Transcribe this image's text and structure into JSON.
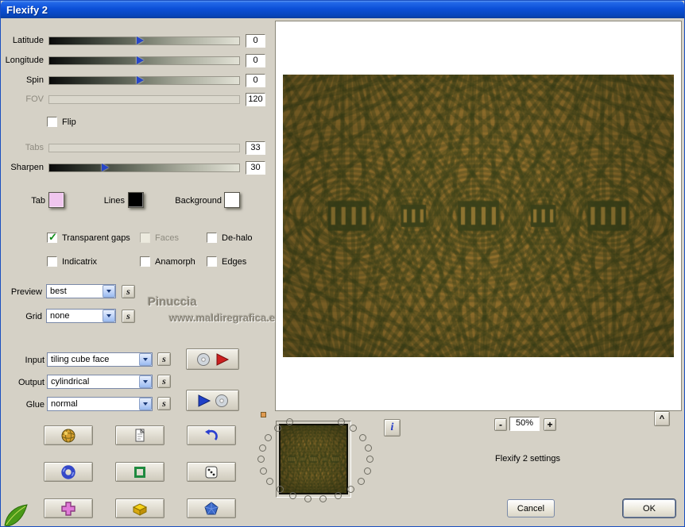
{
  "window": {
    "title": "Flexify 2"
  },
  "sliders": {
    "latitude": {
      "label": "Latitude",
      "value": "0"
    },
    "longitude": {
      "label": "Longitude",
      "value": "0"
    },
    "spin": {
      "label": "Spin",
      "value": "0"
    },
    "fov": {
      "label": "FOV",
      "value": "120"
    },
    "tabs": {
      "label": "Tabs",
      "value": "33"
    },
    "sharpen": {
      "label": "Sharpen",
      "value": "30"
    }
  },
  "checkboxes": {
    "flip": {
      "label": "Flip",
      "checked": false
    },
    "transparent_gaps": {
      "label": "Transparent gaps",
      "checked": true
    },
    "faces": {
      "label": "Faces",
      "checked": false
    },
    "dehalo": {
      "label": "De-halo",
      "checked": false
    },
    "indicatrix": {
      "label": "Indicatrix",
      "checked": false
    },
    "anamorph": {
      "label": "Anamorph",
      "checked": false
    },
    "edges": {
      "label": "Edges",
      "checked": false
    }
  },
  "swatches": {
    "tab": {
      "label": "Tab",
      "color": "#f0c6ee"
    },
    "lines": {
      "label": "Lines",
      "color": "#000000"
    },
    "background": {
      "label": "Background",
      "color": "#ffffff"
    }
  },
  "combos": {
    "preview": {
      "label": "Preview",
      "value": "best"
    },
    "grid": {
      "label": "Grid",
      "value": "none"
    },
    "input": {
      "label": "Input",
      "value": "tiling cube face"
    },
    "output": {
      "label": "Output",
      "value": "cylindrical"
    },
    "glue": {
      "label": "Glue",
      "value": "normal"
    }
  },
  "s_button_label": "s",
  "watermark": {
    "line1": "Pinuccia",
    "line2": "www.maldiregrafica.eu"
  },
  "bottom": {
    "info_label": "i",
    "zoom_out": "-",
    "zoom_value": "50%",
    "zoom_in": "+",
    "caret": "^",
    "settings_text": "Flexify 2 settings",
    "cancel_label": "Cancel",
    "ok_label": "OK"
  },
  "pattern_colors": {
    "base": "#8f6e2c",
    "dark": "#3a4019",
    "light": "#b28a3c"
  }
}
